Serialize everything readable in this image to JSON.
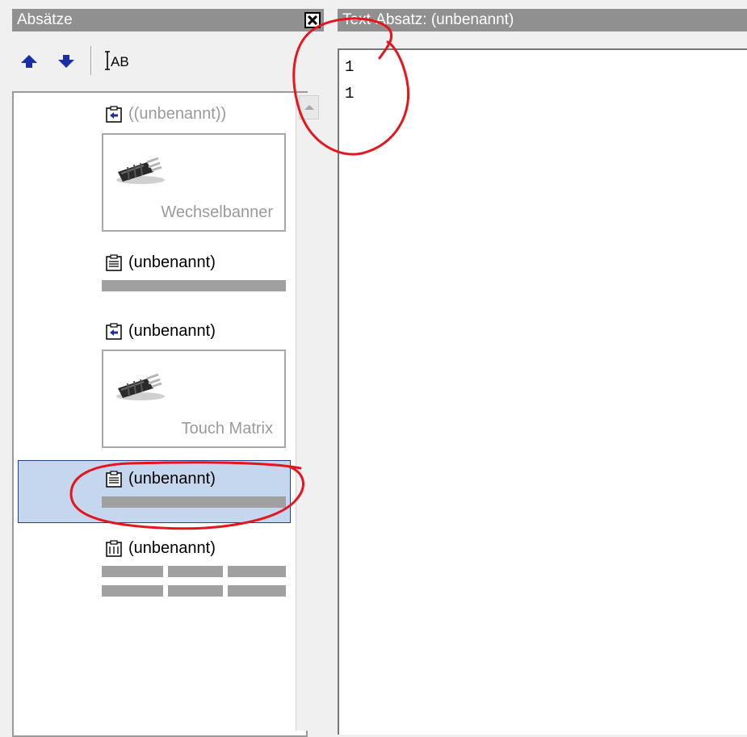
{
  "left_panel": {
    "title": "Absätze",
    "toolbar": {
      "move_up_icon": "arrow-up-icon",
      "move_down_icon": "arrow-down-icon",
      "rename_icon": "text-cursor-ab-icon",
      "rename_label": "AB"
    },
    "items": [
      {
        "title": "((unbenannt))",
        "type": "banner",
        "caption": "Wechselbanner",
        "dimmed": true
      },
      {
        "title": "(unbenannt)",
        "type": "text"
      },
      {
        "title": "(unbenannt)",
        "type": "banner",
        "caption": "Touch Matrix"
      },
      {
        "title": "(unbenannt)",
        "type": "text",
        "selected": true
      },
      {
        "title": "(unbenannt)",
        "type": "table"
      }
    ]
  },
  "right_panel": {
    "title": "Text-Absatz: (unbenannt)",
    "lines": [
      "1",
      "1"
    ]
  },
  "colors": {
    "titlebar": "#909090",
    "selection": "#c5d6ef",
    "annotation": "#e8141c"
  }
}
